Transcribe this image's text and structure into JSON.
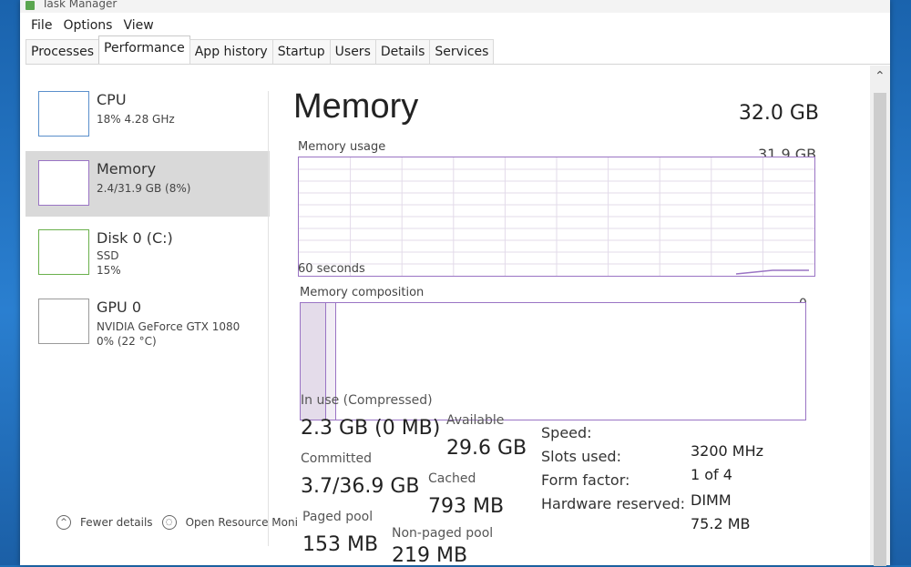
{
  "window": {
    "title": "Task Manager"
  },
  "menu": [
    "File",
    "Options",
    "View"
  ],
  "tabs": [
    {
      "label": "Processes",
      "active": false
    },
    {
      "label": "Performance",
      "active": true
    },
    {
      "label": "App history",
      "active": false
    },
    {
      "label": "Startup",
      "active": false
    },
    {
      "label": "Users",
      "active": false
    },
    {
      "label": "Details",
      "active": false
    },
    {
      "label": "Services",
      "active": false
    }
  ],
  "sidebar": {
    "items": [
      {
        "title": "CPU",
        "sub1": "18% 4.28 GHz",
        "sub2": "",
        "sub3": "",
        "color": "#5a8fcb"
      },
      {
        "title": "Memory",
        "sub1": "2.4/31.9 GB (8%)",
        "sub2": "",
        "sub3": "",
        "color": "#9a74c4"
      },
      {
        "title": "Disk 0 (C:)",
        "sub1": "SSD",
        "sub2": "15%",
        "sub3": "",
        "color": "#6ab04c"
      },
      {
        "title": "GPU 0",
        "sub1": "NVIDIA GeForce GTX 1080",
        "sub2": "0% (22 °C)",
        "sub3": "",
        "color": "#9a9a9a"
      }
    ]
  },
  "footer": {
    "fewer_details": "Fewer details",
    "open_resource_monitor": "Open Resource Moni"
  },
  "main": {
    "title": "Memory",
    "total": "32.0 GB",
    "usage_label": "Memory usage",
    "usage_max": "31.9 GB",
    "time_label": "60 seconds",
    "zero_label": "0",
    "composition_label": "Memory composition",
    "in_use_fraction": 0.08
  },
  "stats": {
    "in_use_label": "In use (Compressed)",
    "in_use_value": "2.3 GB (0 MB)",
    "available_label": "Available",
    "available_value": "29.6 GB",
    "committed_label": "Committed",
    "committed_value": "3.7/36.9 GB",
    "cached_label": "Cached",
    "cached_value": "793 MB",
    "paged_label": "Paged pool",
    "paged_value": "153 MB",
    "nonpaged_label": "Non-paged pool",
    "nonpaged_value": "219 MB"
  },
  "specs": {
    "speed_label": "Speed:",
    "speed_value": "3200 MHz",
    "slots_label": "Slots used:",
    "slots_value": "1 of 4",
    "form_label": "Form factor:",
    "form_value": "DIMM",
    "reserved_label": "Hardware reserved:",
    "reserved_value": "75.2 MB"
  }
}
